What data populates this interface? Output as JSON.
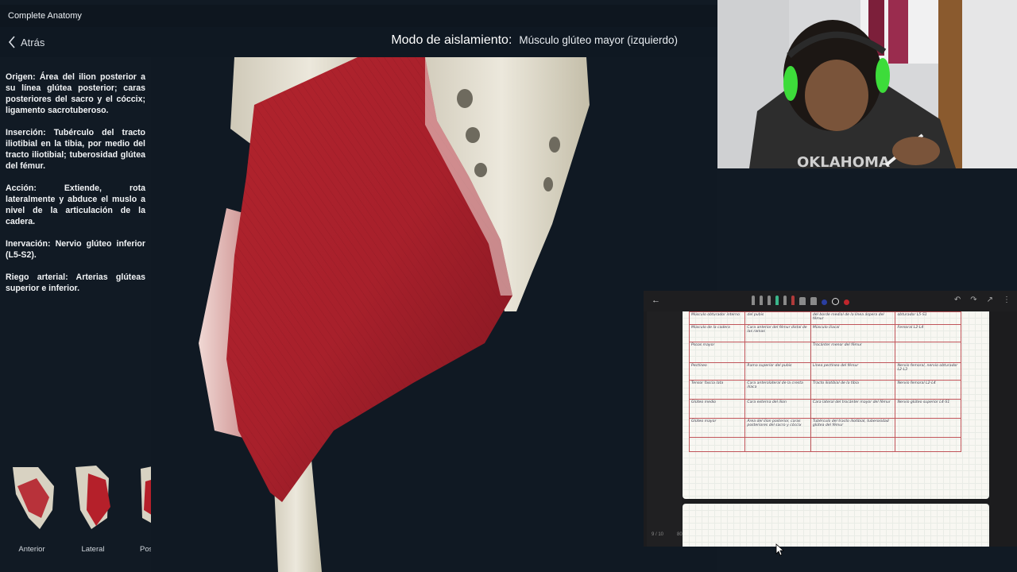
{
  "app": {
    "title": "Complete Anatomy"
  },
  "topbar": {
    "back_label": "Atrás",
    "mode_label": "Modo de aislamiento:",
    "muscle_name": "Músculo glúteo mayor (izquierdo)"
  },
  "info": {
    "origin": "Origen: Área del ilion posterior a su línea glútea posterior; caras posteriores del sacro y el cóccix; ligamento sacrotuberoso.",
    "insertion": "Inserción: Tubérculo del tracto iliotibial en la tibia, por medio del tracto iliotibial; tuberosidad glútea del fémur.",
    "action": "Acción: Extiende, rota lateralmente y abduce el muslo a nivel de la articulación de la cadera.",
    "innervation": "Inervación: Nervio glúteo inferior (L5-S2).",
    "blood": "Riego arterial: Arterias glúteas superior e inferior."
  },
  "views": [
    {
      "label": "Anterior"
    },
    {
      "label": "Lateral"
    },
    {
      "label": "Pos"
    }
  ],
  "colors": {
    "muscle": "#a3202a",
    "bone": "#e6e1d3",
    "background": "#111a24",
    "table_line": "#c0555a"
  },
  "tablet": {
    "back_icon": "arrow-left-icon",
    "page_number": "9 / 10",
    "zoom": "80"
  },
  "notes_table": {
    "rows": [
      [
        "Músculo obturador interno",
        "del pubis",
        "del borde medial de la línea áspera del fémur",
        "obturador L5-S1"
      ],
      [
        "Músculo de la cadera",
        "Cara anterior del fémur distal de las ramas",
        "Músculo iliacal",
        "Femoral L2-L4"
      ],
      [
        "Psoas mayor",
        "",
        "Trocánter menor del fémur",
        ""
      ],
      [
        "Pectíneo",
        "Rama superior del pubis",
        "Línea pectínea del fémur",
        "Nervio femoral, nervio obturador L2-L3"
      ],
      [
        "Tensor fascia lata",
        "Cara anterolateral de la cresta ilíaca",
        "Tracto iliotibial de la tibia",
        "Nervio femoral L2-L4"
      ],
      [
        "Glúteo medio",
        "Cara externa del ilion",
        "Cara lateral del trocánter mayor del fémur",
        "Nervio glúteo superior L4-S1"
      ],
      [
        "Glúteo mayor",
        "Área del ilion posterior, caras posteriores del sacro y cóccix",
        "Tubérculo del tracto iliotibial, tuberosidad glútea del fémur",
        ""
      ],
      [
        "",
        "",
        "",
        ""
      ]
    ]
  }
}
